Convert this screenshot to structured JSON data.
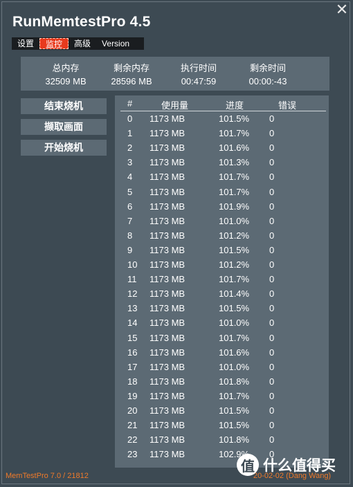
{
  "app": {
    "title": "RunMemtestPro 4.5",
    "close_glyph": "✕"
  },
  "tabs": [
    {
      "label": "设置",
      "active": false
    },
    {
      "label": "监控",
      "active": true
    },
    {
      "label": "高级",
      "active": false
    },
    {
      "label": "Version",
      "active": false
    }
  ],
  "stats": {
    "headers": [
      "总内存",
      "剩余内存",
      "执行时间",
      "剩余时间"
    ],
    "values": [
      "32509 MB",
      "28596 MB",
      "00:47:59",
      "00:00:-43"
    ]
  },
  "buttons": {
    "stop": "结束烧机",
    "capture": "撷取画面",
    "start": "开始烧机"
  },
  "table": {
    "columns": [
      "#",
      "使用量",
      "进度",
      "错误"
    ],
    "rows": [
      [
        "0",
        "1173 MB",
        "101.5%",
        "0"
      ],
      [
        "1",
        "1173 MB",
        "101.7%",
        "0"
      ],
      [
        "2",
        "1173 MB",
        "101.6%",
        "0"
      ],
      [
        "3",
        "1173 MB",
        "101.3%",
        "0"
      ],
      [
        "4",
        "1173 MB",
        "101.7%",
        "0"
      ],
      [
        "5",
        "1173 MB",
        "101.7%",
        "0"
      ],
      [
        "6",
        "1173 MB",
        "101.9%",
        "0"
      ],
      [
        "7",
        "1173 MB",
        "101.0%",
        "0"
      ],
      [
        "8",
        "1173 MB",
        "101.2%",
        "0"
      ],
      [
        "9",
        "1173 MB",
        "101.5%",
        "0"
      ],
      [
        "10",
        "1173 MB",
        "101.2%",
        "0"
      ],
      [
        "11",
        "1173 MB",
        "101.7%",
        "0"
      ],
      [
        "12",
        "1173 MB",
        "101.4%",
        "0"
      ],
      [
        "13",
        "1173 MB",
        "101.5%",
        "0"
      ],
      [
        "14",
        "1173 MB",
        "101.0%",
        "0"
      ],
      [
        "15",
        "1173 MB",
        "101.7%",
        "0"
      ],
      [
        "16",
        "1173 MB",
        "101.6%",
        "0"
      ],
      [
        "17",
        "1173 MB",
        "101.0%",
        "0"
      ],
      [
        "18",
        "1173 MB",
        "101.8%",
        "0"
      ],
      [
        "19",
        "1173 MB",
        "101.7%",
        "0"
      ],
      [
        "20",
        "1173 MB",
        "101.5%",
        "0"
      ],
      [
        "21",
        "1173 MB",
        "101.5%",
        "0"
      ],
      [
        "22",
        "1173 MB",
        "101.8%",
        "0"
      ],
      [
        "23",
        "1173 MB",
        "102.9%",
        "0"
      ]
    ]
  },
  "footer": {
    "left": "MemTestPro 7.0 / 21812",
    "right": "20-02-02 (Dang Wang)"
  },
  "watermark": {
    "logo": "值",
    "text": "什么值得买"
  },
  "colors": {
    "background": "#3d4a53",
    "panel": "#5c6a74",
    "accent": "#e83a1d",
    "footer": "#f07a2a"
  }
}
